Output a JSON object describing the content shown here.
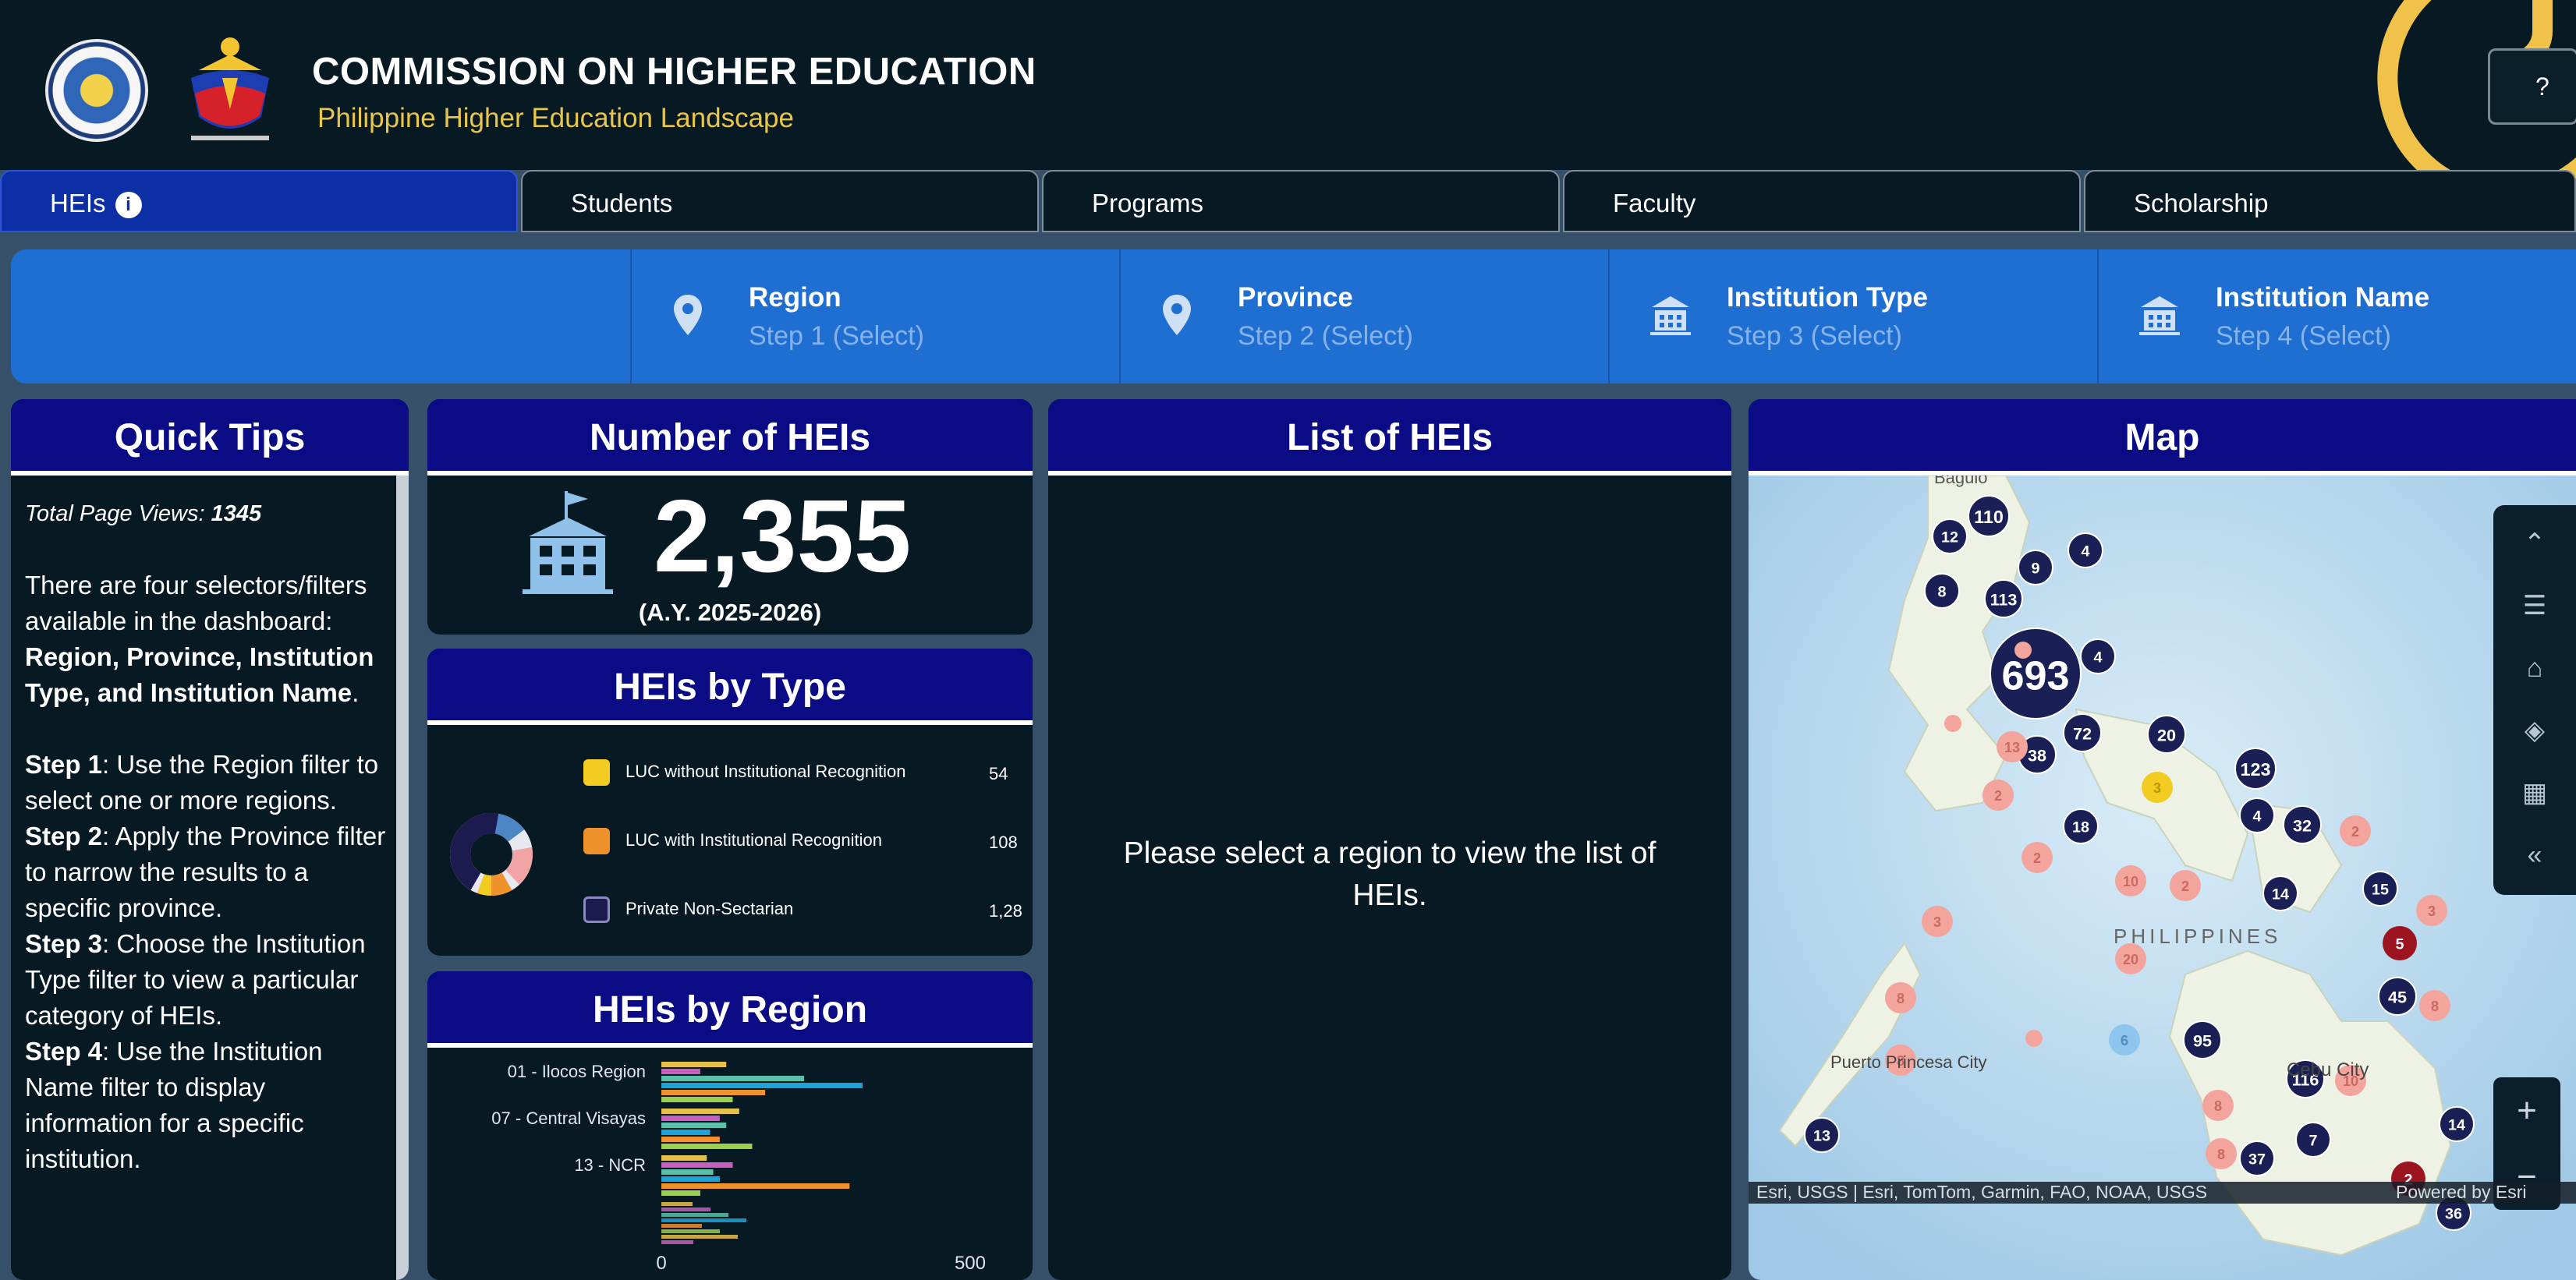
{
  "header": {
    "title": "COMMISSION ON HIGHER EDUCATION",
    "subtitle": "Philippine Higher Education Landscape"
  },
  "tabs": [
    {
      "label": "HEIs",
      "active": true
    },
    {
      "label": "Students",
      "active": false
    },
    {
      "label": "Programs",
      "active": false
    },
    {
      "label": "Faculty",
      "active": false
    },
    {
      "label": "Scholarship",
      "active": false
    }
  ],
  "filters": [
    {
      "label": "Region",
      "step": "Step 1 (Select)",
      "icon": "map-pin-icon"
    },
    {
      "label": "Province",
      "step": "Step 2 (Select)",
      "icon": "map-pin-icon"
    },
    {
      "label": "Institution Type",
      "step": "Step 3 (Select)",
      "icon": "institution-icon"
    },
    {
      "label": "Institution Name",
      "step": "Step 4 (Select)",
      "icon": "institution-icon"
    }
  ],
  "quick_tips": {
    "title": "Quick Tips",
    "page_views_label": "Total Page Views:",
    "page_views": "1345",
    "intro": "There are four selectors/filters available in the dashboard:",
    "intro_bold": "Region, Province, Institution Type, and Institution Name",
    "steps": [
      {
        "label": "Step 1",
        "text": ": Use the Region filter to select one or more regions."
      },
      {
        "label": "Step 2",
        "text": ": Apply the Province filter to narrow the results to a specific province."
      },
      {
        "label": "Step 3",
        "text": ": Choose the Institution Type filter to view a particular category of HEIs."
      },
      {
        "label": "Step 4",
        "text": ": Use the Institution Name filter to display information for a specific institution."
      }
    ]
  },
  "number_of_heis": {
    "title": "Number of HEIs",
    "value": "2,355",
    "academic_year": "(A.Y. 2025-2026)"
  },
  "heis_by_type": {
    "title": "HEIs by Type",
    "legend": [
      {
        "label": "LUC without Institutional Recognition",
        "value": "54",
        "color": "#f2cc21"
      },
      {
        "label": "LUC with Institutional Recognition",
        "value": "108",
        "color": "#f0922b"
      },
      {
        "label": "Private Non-Sectarian",
        "value": "1,28",
        "color": "#1b1b4f"
      }
    ]
  },
  "heis_by_region": {
    "title": "HEIs by Region"
  },
  "list_of_heis": {
    "title": "List of HEIs",
    "message": "Please select a region to view the list of HEIs."
  },
  "map": {
    "title": "Map",
    "labels": [
      "Baguio",
      "PHILIPPINES",
      "Puerto Princesa City",
      "Cebu City"
    ],
    "attribution": "Esri, USGS | Esri, TomTom, Garmin, FAO, NOAA, USGS",
    "powered_by": "Powered by Esri",
    "clusters": [
      "110",
      "12",
      "4",
      "9",
      "8",
      "113",
      "693",
      "4",
      "20",
      "72",
      "38",
      "123",
      "4",
      "32",
      "18",
      "2",
      "3",
      "10",
      "2",
      "14",
      "15",
      "5",
      "20",
      "6",
      "45",
      "8",
      "13",
      "2",
      "95",
      "116",
      "10",
      "13",
      "7",
      "37",
      "14",
      "2",
      "36",
      "8",
      "3",
      "2",
      "8",
      "8",
      "8",
      "3"
    ]
  },
  "chart_data": {
    "type": "bar",
    "title": "HEIs by Region",
    "categories": [
      "01 - Ilocos Region",
      "07 - Central Visayas",
      "13 - NCR"
    ],
    "xlim": [
      0,
      500
    ],
    "x_ticks": [
      "0",
      "500"
    ],
    "series": [
      {
        "color": "#e8c14a",
        "values": [
          100,
          120,
          70
        ]
      },
      {
        "color": "#c65fbd",
        "values": [
          60,
          90,
          110
        ]
      },
      {
        "color": "#5bc0a8",
        "values": [
          220,
          100,
          80
        ]
      },
      {
        "color": "#1ea3d8",
        "values": [
          310,
          75,
          90
        ]
      },
      {
        "color": "#f0922b",
        "values": [
          160,
          90,
          290
        ]
      },
      {
        "color": "#9ccf4d",
        "values": [
          110,
          140,
          60
        ]
      }
    ]
  },
  "icons": {
    "help": "question-person-icon",
    "info": "info-icon",
    "building": "school-building-icon"
  }
}
